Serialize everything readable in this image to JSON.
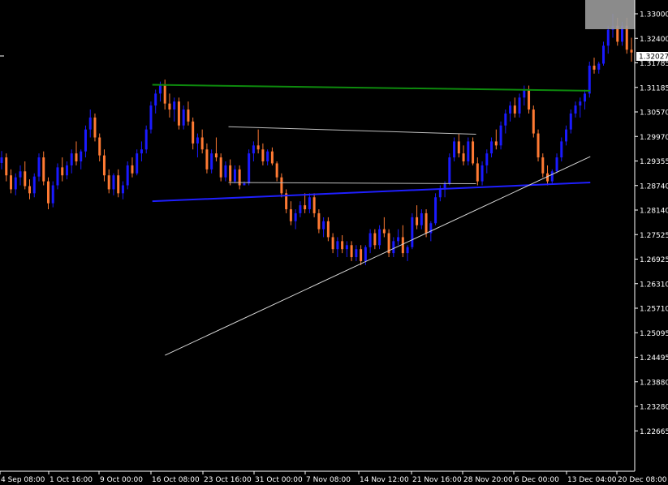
{
  "chart_data": {
    "type": "candlestick",
    "title": "",
    "xlabel": "",
    "ylabel": "",
    "ylim": [
      1.2631,
      1.33
    ],
    "colors": {
      "background": "#000000",
      "axis": "#ffffff",
      "bull": "#1a1aff",
      "bear": "#ff7a33",
      "support_line": "#1f1fff",
      "resistance_line": "#0d8a0d",
      "channel_line": "#bfbfbf",
      "trend_line": "#d9d9d9",
      "price_label_bg": "#ffffff",
      "price_label_text": "#000000",
      "overlay_box": "#9a9a9a"
    },
    "y_ticks": [
      "1.33000",
      "1.32400",
      "1.31785",
      "1.31185",
      "1.30570",
      "1.29970",
      "1.29355",
      "1.28740",
      "1.28140",
      "1.27525",
      "1.26925",
      "1.26310",
      "1.25710",
      "1.25095",
      "1.24495",
      "1.23880",
      "1.23280",
      "1.22665"
    ],
    "x_ticks": [
      "4 Sep 08:00",
      "1 Oct 16:00",
      "9 Oct 00:00",
      "16 Oct 08:00",
      "23 Oct 16:00",
      "31 Oct 00:00",
      "7 Nov 08:00",
      "14 Nov 12:00",
      "21 Nov 16:00",
      "28 Nov 20:00",
      "6 Dec 00:00",
      "13 Dec 04:00",
      "20 Dec 08:00"
    ],
    "current_price": "1.32027",
    "trendlines": [
      {
        "name": "resistance",
        "from": {
          "bar": 0.24,
          "price": 1.3122
        },
        "to": {
          "bar": 0.93,
          "price": 1.3107
        },
        "style": "resistance_line"
      },
      {
        "name": "support",
        "from": {
          "bar": 0.24,
          "price": 1.283
        },
        "to": {
          "bar": 0.93,
          "price": 1.2877
        },
        "style": "support_line"
      },
      {
        "name": "channel-top",
        "from": {
          "bar": 0.36,
          "price": 1.3017
        },
        "to": {
          "bar": 0.75,
          "price": 1.2998
        },
        "style": "channel_line"
      },
      {
        "name": "channel-bottom",
        "from": {
          "bar": 0.36,
          "price": 1.2877
        },
        "to": {
          "bar": 0.75,
          "price": 1.2874
        },
        "style": "channel_line"
      },
      {
        "name": "rising-trend",
        "from": {
          "bar": 0.26,
          "price": 1.2444
        },
        "to": {
          "bar": 0.93,
          "price": 1.2942
        },
        "style": "trend_line"
      }
    ],
    "series": [
      {
        "values": [
          [
            1.2926,
            1.2956,
            1.291,
            1.294
          ],
          [
            1.294,
            1.295,
            1.288,
            1.2895
          ],
          [
            1.2895,
            1.291,
            1.285,
            1.286
          ],
          [
            1.286,
            1.29,
            1.2845,
            1.289
          ],
          [
            1.289,
            1.292,
            1.287,
            1.2905
          ],
          [
            1.2905,
            1.293,
            1.286,
            1.2868
          ],
          [
            1.2868,
            1.2885,
            1.2835,
            1.285
          ],
          [
            1.285,
            1.29,
            1.284,
            1.2892
          ],
          [
            1.2892,
            1.295,
            1.288,
            1.294
          ],
          [
            1.294,
            1.2955,
            1.287,
            1.288
          ],
          [
            1.288,
            1.289,
            1.281,
            1.2825
          ],
          [
            1.2825,
            1.288,
            1.2815,
            1.287
          ],
          [
            1.287,
            1.2925,
            1.286,
            1.2915
          ],
          [
            1.2915,
            1.294,
            1.288,
            1.2895
          ],
          [
            1.2895,
            1.293,
            1.2885,
            1.292
          ],
          [
            1.292,
            1.296,
            1.29,
            1.295
          ],
          [
            1.295,
            1.298,
            1.292,
            1.293
          ],
          [
            1.293,
            1.296,
            1.291,
            1.2955
          ],
          [
            1.2955,
            1.302,
            1.294,
            1.301
          ],
          [
            1.301,
            1.306,
            1.299,
            1.304
          ],
          [
            1.304,
            1.305,
            1.298,
            1.299
          ],
          [
            1.299,
            1.3,
            1.293,
            1.2945
          ],
          [
            1.2945,
            1.296,
            1.288,
            1.2895
          ],
          [
            1.2895,
            1.291,
            1.285,
            1.286
          ],
          [
            1.286,
            1.29,
            1.2845,
            1.2895
          ],
          [
            1.2895,
            1.291,
            1.284,
            1.285
          ],
          [
            1.285,
            1.288,
            1.2835,
            1.287
          ],
          [
            1.287,
            1.293,
            1.286,
            1.292
          ],
          [
            1.292,
            1.294,
            1.289,
            1.29
          ],
          [
            1.29,
            1.296,
            1.2895,
            1.295
          ],
          [
            1.295,
            1.298,
            1.293,
            1.296
          ],
          [
            1.296,
            1.302,
            1.295,
            1.301
          ],
          [
            1.301,
            1.308,
            1.3,
            1.307
          ],
          [
            1.307,
            1.311,
            1.305,
            1.31
          ],
          [
            1.31,
            1.313,
            1.308,
            1.312
          ],
          [
            1.312,
            1.3135,
            1.306,
            1.3075
          ],
          [
            1.3075,
            1.31,
            1.304,
            1.306
          ],
          [
            1.306,
            1.309,
            1.303,
            1.308
          ],
          [
            1.308,
            1.309,
            1.301,
            1.302
          ],
          [
            1.302,
            1.307,
            1.301,
            1.306
          ],
          [
            1.306,
            1.308,
            1.302,
            1.303
          ],
          [
            1.303,
            1.304,
            1.296,
            1.2975
          ],
          [
            1.2975,
            1.3,
            1.294,
            1.299
          ],
          [
            1.299,
            1.301,
            1.295,
            1.296
          ],
          [
            1.296,
            1.2975,
            1.29,
            1.291
          ],
          [
            1.291,
            1.296,
            1.29,
            1.295
          ],
          [
            1.295,
            1.299,
            1.293,
            1.294
          ],
          [
            1.294,
            1.295,
            1.288,
            1.289
          ],
          [
            1.289,
            1.293,
            1.288,
            1.292
          ],
          [
            1.292,
            1.2935,
            1.287,
            1.288
          ],
          [
            1.288,
            1.292,
            1.2875,
            1.291
          ],
          [
            1.291,
            1.292,
            1.286,
            1.287
          ],
          [
            1.287,
            1.288,
            1.287,
            1.2875
          ],
          [
            1.2875,
            1.296,
            1.287,
            1.295
          ],
          [
            1.295,
            1.298,
            1.293,
            1.297
          ],
          [
            1.297,
            1.301,
            1.295,
            1.296
          ],
          [
            1.296,
            1.2975,
            1.292,
            1.293
          ],
          [
            1.293,
            1.296,
            1.292,
            1.2955
          ],
          [
            1.2955,
            1.2965,
            1.292,
            1.2925
          ],
          [
            1.2925,
            1.293,
            1.288,
            1.289
          ],
          [
            1.289,
            1.29,
            1.284,
            1.285
          ],
          [
            1.285,
            1.286,
            1.28,
            1.281
          ],
          [
            1.281,
            1.283,
            1.277,
            1.278
          ],
          [
            1.278,
            1.281,
            1.276,
            1.28
          ],
          [
            1.28,
            1.283,
            1.279,
            1.282
          ],
          [
            1.282,
            1.285,
            1.28,
            1.281
          ],
          [
            1.281,
            1.285,
            1.28,
            1.284
          ],
          [
            1.284,
            1.285,
            1.279,
            1.28
          ],
          [
            1.28,
            1.281,
            1.275,
            1.276
          ],
          [
            1.276,
            1.279,
            1.274,
            1.278
          ],
          [
            1.278,
            1.279,
            1.273,
            1.274
          ],
          [
            1.274,
            1.275,
            1.27,
            1.271
          ],
          [
            1.271,
            1.274,
            1.269,
            1.273
          ],
          [
            1.273,
            1.2745,
            1.27,
            1.271
          ],
          [
            1.271,
            1.273,
            1.269,
            1.272
          ],
          [
            1.272,
            1.273,
            1.268,
            1.269
          ],
          [
            1.269,
            1.272,
            1.268,
            1.271
          ],
          [
            1.271,
            1.272,
            1.267,
            1.268
          ],
          [
            1.268,
            1.272,
            1.267,
            1.2715
          ],
          [
            1.2715,
            1.276,
            1.27,
            1.275
          ],
          [
            1.275,
            1.276,
            1.271,
            1.272
          ],
          [
            1.272,
            1.277,
            1.271,
            1.276
          ],
          [
            1.276,
            1.279,
            1.274,
            1.275
          ],
          [
            1.275,
            1.276,
            1.269,
            1.27
          ],
          [
            1.27,
            1.274,
            1.269,
            1.273
          ],
          [
            1.273,
            1.276,
            1.272,
            1.274
          ],
          [
            1.274,
            1.277,
            1.269,
            1.27
          ],
          [
            1.27,
            1.272,
            1.268,
            1.2715
          ],
          [
            1.2715,
            1.28,
            1.271,
            1.279
          ],
          [
            1.279,
            1.282,
            1.276,
            1.277
          ],
          [
            1.277,
            1.281,
            1.276,
            1.28
          ],
          [
            1.28,
            1.281,
            1.274,
            1.275
          ],
          [
            1.275,
            1.278,
            1.273,
            1.2775
          ],
          [
            1.2775,
            1.285,
            1.277,
            1.284
          ],
          [
            1.284,
            1.287,
            1.283,
            1.286
          ],
          [
            1.286,
            1.288,
            1.284,
            1.2875
          ],
          [
            1.2875,
            1.295,
            1.287,
            1.294
          ],
          [
            1.294,
            1.299,
            1.293,
            1.298
          ],
          [
            1.298,
            1.3,
            1.294,
            1.295
          ],
          [
            1.295,
            1.297,
            1.292,
            1.293
          ],
          [
            1.293,
            1.299,
            1.292,
            1.298
          ],
          [
            1.298,
            1.299,
            1.292,
            1.2925
          ],
          [
            1.2925,
            1.294,
            1.287,
            1.288
          ],
          [
            1.288,
            1.293,
            1.287,
            1.292
          ],
          [
            1.292,
            1.296,
            1.29,
            1.295
          ],
          [
            1.295,
            1.299,
            1.294,
            1.298
          ],
          [
            1.298,
            1.301,
            1.296,
            1.297
          ],
          [
            1.297,
            1.303,
            1.296,
            1.302
          ],
          [
            1.302,
            1.306,
            1.3,
            1.305
          ],
          [
            1.305,
            1.308,
            1.303,
            1.307
          ],
          [
            1.307,
            1.309,
            1.304,
            1.305
          ],
          [
            1.305,
            1.31,
            1.304,
            1.309
          ],
          [
            1.309,
            1.312,
            1.307,
            1.311
          ],
          [
            1.311,
            1.312,
            1.305,
            1.306
          ],
          [
            1.306,
            1.307,
            1.299,
            1.3
          ],
          [
            1.3,
            1.301,
            1.293,
            1.294
          ],
          [
            1.294,
            1.295,
            1.289,
            1.29
          ],
          [
            1.29,
            1.292,
            1.287,
            1.288
          ],
          [
            1.288,
            1.291,
            1.2875,
            1.2905
          ],
          [
            1.2905,
            1.295,
            1.29,
            1.294
          ],
          [
            1.294,
            1.299,
            1.293,
            1.298
          ],
          [
            1.298,
            1.302,
            1.297,
            1.301
          ],
          [
            1.301,
            1.306,
            1.3,
            1.305
          ],
          [
            1.305,
            1.308,
            1.304,
            1.307
          ],
          [
            1.307,
            1.309,
            1.304,
            1.308
          ],
          [
            1.308,
            1.311,
            1.306,
            1.31
          ],
          [
            1.31,
            1.318,
            1.309,
            1.317
          ],
          [
            1.317,
            1.319,
            1.315,
            1.316
          ],
          [
            1.316,
            1.318,
            1.315,
            1.3175
          ],
          [
            1.3175,
            1.323,
            1.317,
            1.322
          ],
          [
            1.322,
            1.327,
            1.32,
            1.326
          ],
          [
            1.326,
            1.33,
            1.324,
            1.327
          ],
          [
            1.327,
            1.329,
            1.322,
            1.323
          ],
          [
            1.323,
            1.328,
            1.322,
            1.327
          ],
          [
            1.327,
            1.329,
            1.32,
            1.321
          ],
          [
            1.321,
            1.324,
            1.318,
            1.3203
          ]
        ]
      }
    ]
  }
}
